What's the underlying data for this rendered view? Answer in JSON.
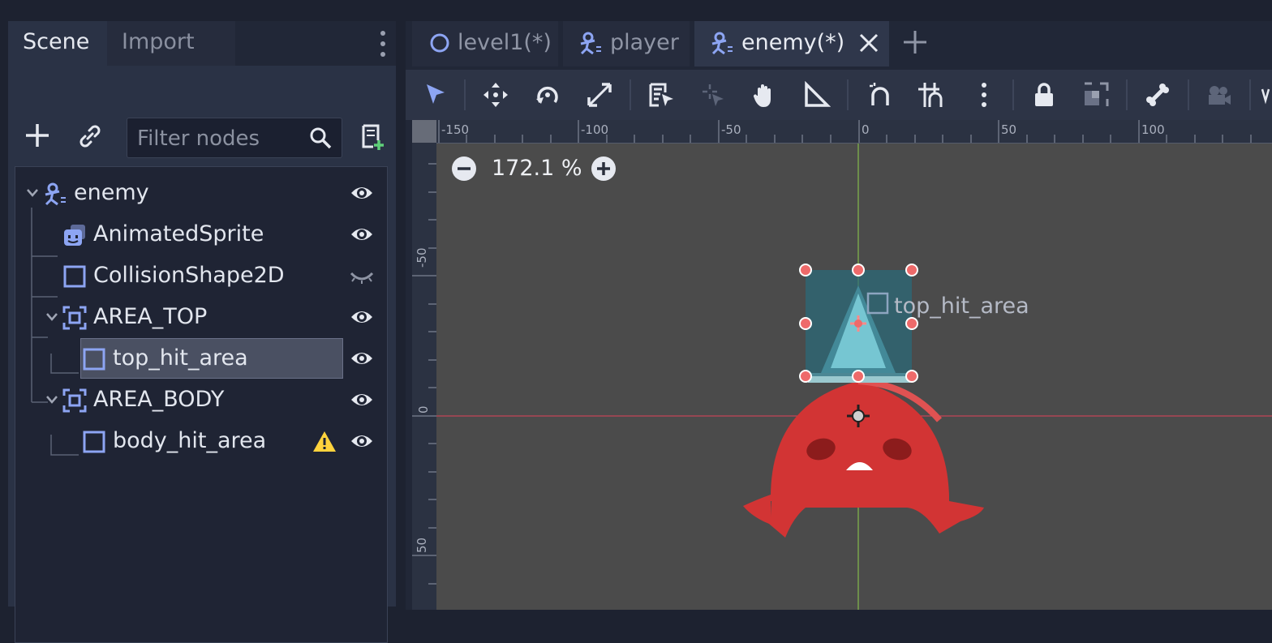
{
  "dock": {
    "tabs": [
      {
        "label": "Scene",
        "active": true
      },
      {
        "label": "Import",
        "active": false
      }
    ],
    "filter_placeholder": "Filter nodes"
  },
  "tree": {
    "nodes": [
      {
        "label": "enemy",
        "icon": "kinematic-body-icon",
        "depth": 0,
        "expanded": true,
        "visible": true
      },
      {
        "label": "AnimatedSprite",
        "icon": "animated-sprite-icon",
        "depth": 1,
        "visible": true
      },
      {
        "label": "CollisionShape2D",
        "icon": "collision-shape-icon",
        "depth": 1,
        "visible": false
      },
      {
        "label": "AREA_TOP",
        "icon": "area2d-icon",
        "depth": 1,
        "expanded": true,
        "visible": true
      },
      {
        "label": "top_hit_area",
        "icon": "collision-shape-icon",
        "depth": 2,
        "selected": true,
        "visible": true
      },
      {
        "label": "AREA_BODY",
        "icon": "area2d-icon",
        "depth": 1,
        "expanded": true,
        "visible": true
      },
      {
        "label": "body_hit_area",
        "icon": "collision-shape-icon",
        "depth": 2,
        "warning": true,
        "visible": true
      }
    ]
  },
  "editor": {
    "tabs": [
      {
        "label": "level1(*)",
        "icon": "node2d-circle-icon",
        "active": false
      },
      {
        "label": "player",
        "icon": "kinematic-body-icon",
        "active": false
      },
      {
        "label": "enemy(*)",
        "icon": "kinematic-body-icon",
        "active": true
      }
    ],
    "zoom_level": "172.1 %",
    "canvas_label": "top_hit_area",
    "ruler_top": [
      "-150",
      "-100",
      "-50",
      "0",
      "50",
      "100"
    ],
    "ruler_left": [
      "-50",
      "0",
      "50"
    ]
  },
  "colors": {
    "accent": "#8da5f3",
    "warning": "#ffd33d",
    "enemy_red": "#d23434",
    "area_shape": "#2a6b7a",
    "handle": "#ee6a6a"
  }
}
